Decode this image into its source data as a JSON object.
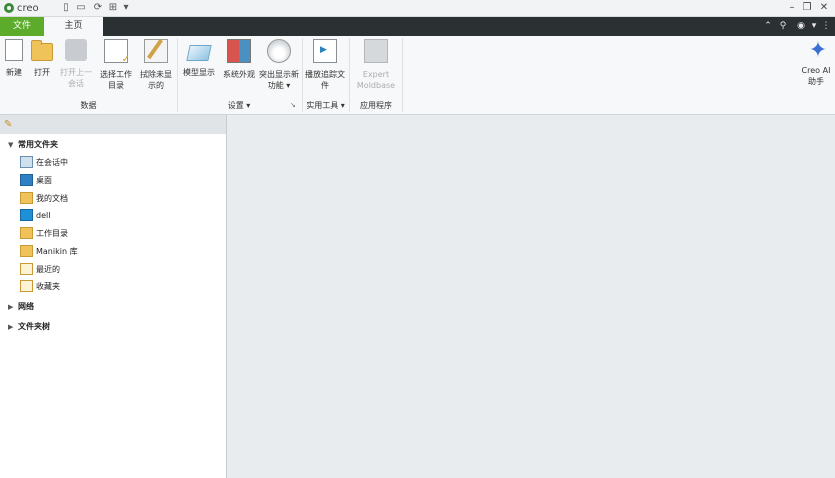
{
  "app": {
    "logo_text": "creo"
  },
  "tabs": {
    "file": "文件",
    "home": "主页"
  },
  "ribbon": {
    "buttons": [
      {
        "id": "new",
        "label": "新建",
        "icon": "new-doc-icon"
      },
      {
        "id": "open",
        "label": "打开",
        "icon": "open-folder-icon"
      },
      {
        "id": "open_last",
        "label": "打开上一会话",
        "icon": "open-last-session-icon"
      },
      {
        "id": "select_dir",
        "label": "选择工作目录",
        "icon": "select-working-dir-icon"
      },
      {
        "id": "erase",
        "label": "拭除未显示的",
        "icon": "erase-not-displayed-icon"
      },
      {
        "id": "model_display",
        "label": "模型显示",
        "icon": "model-display-icon"
      },
      {
        "id": "sys_appearance",
        "label": "系统外观",
        "icon": "system-appearance-icon"
      },
      {
        "id": "highlight_new",
        "label": "突出显示新功能",
        "icon": "highlight-new-features-icon"
      },
      {
        "id": "play_trail",
        "label": "播放追踪文件",
        "icon": "play-trail-file-icon"
      },
      {
        "id": "expert_moldbase",
        "label": "Expert Moldbase",
        "icon": "expert-moldbase-icon"
      },
      {
        "id": "creo_ai",
        "label": "Creo AI 助手",
        "icon": "creo-ai-assistant-icon"
      }
    ],
    "groups": {
      "data": "数据",
      "settings": "设置",
      "utilities": "实用工具",
      "apps": "应用程序"
    }
  },
  "folder_panel": {
    "sections": {
      "common": "常用文件夹",
      "network": "网络",
      "folder_tree": "文件夹树"
    },
    "items": [
      {
        "label": "在会话中",
        "icon": "in-session-icon"
      },
      {
        "label": "桌面",
        "icon": "desktop-icon"
      },
      {
        "label": "我的文档",
        "icon": "my-documents-icon"
      },
      {
        "label": "dell",
        "icon": "dell-icon"
      },
      {
        "label": "工作目录",
        "icon": "working-directory-icon"
      },
      {
        "label": "Manikin 库",
        "icon": "manikin-library-icon"
      },
      {
        "label": "最近的",
        "icon": "recent-icon"
      },
      {
        "label": "收藏夹",
        "icon": "favorites-icon"
      }
    ]
  }
}
